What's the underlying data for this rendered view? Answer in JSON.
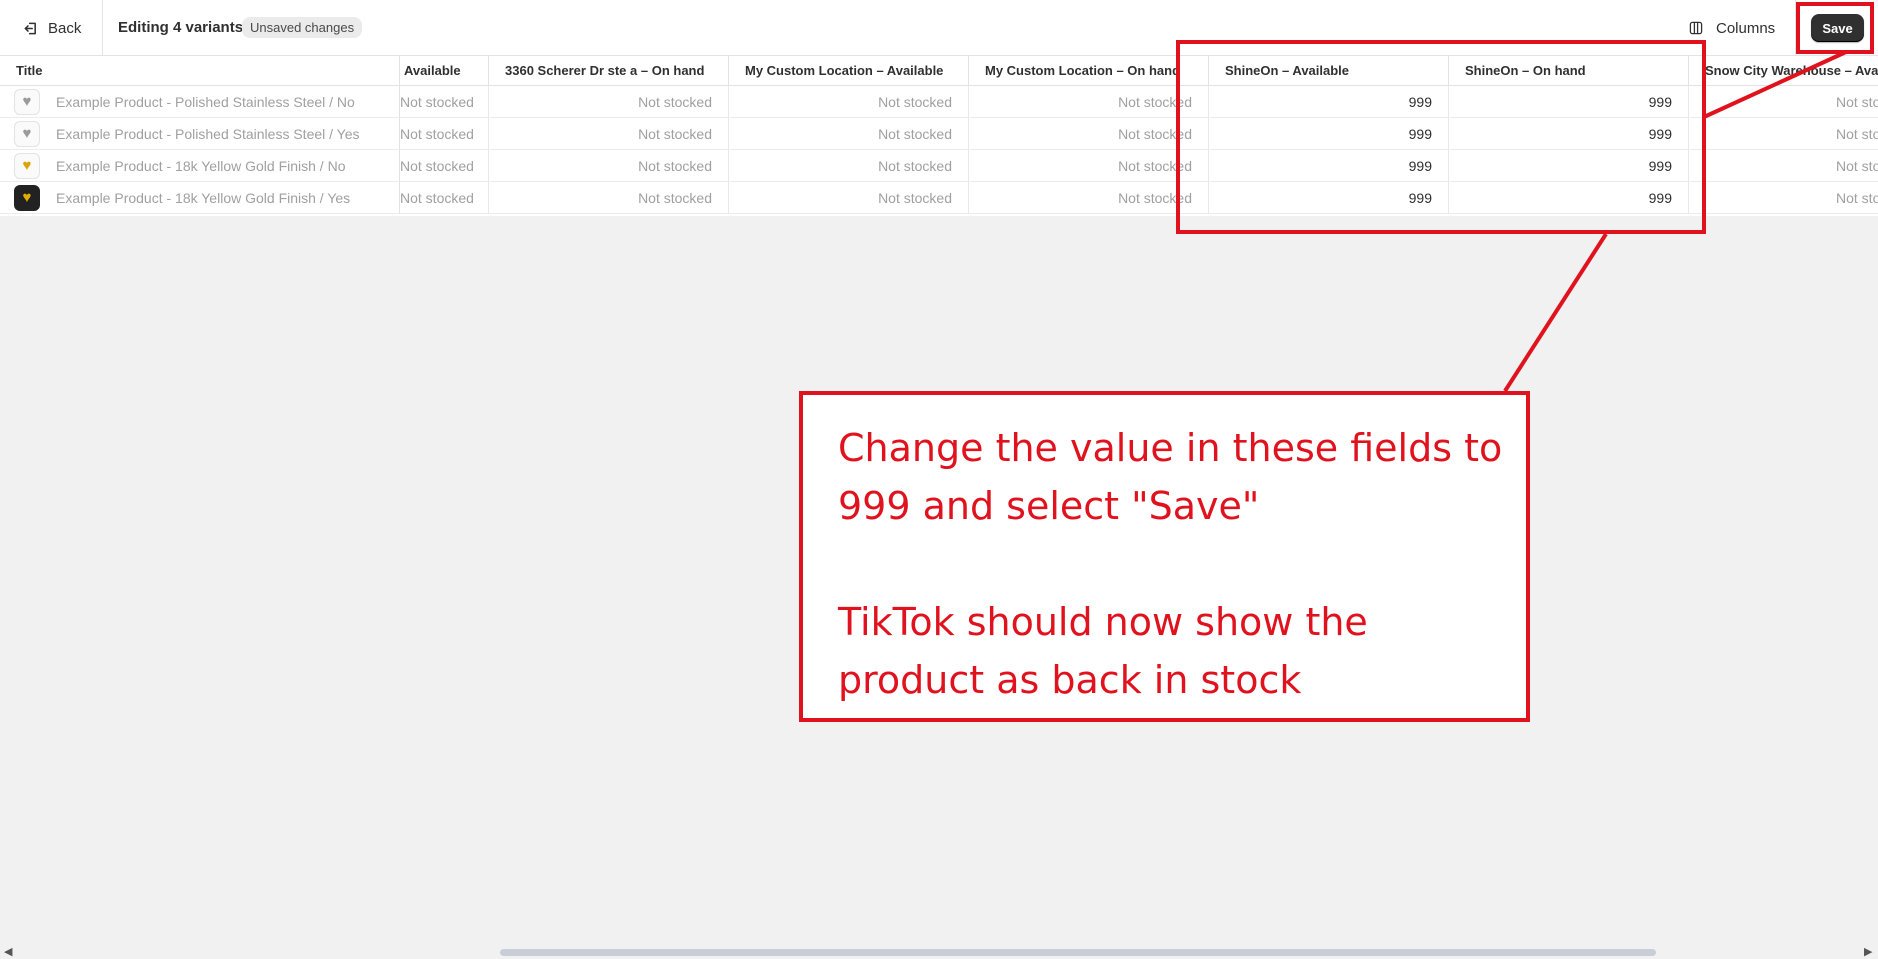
{
  "topbar": {
    "back_label": "Back",
    "title": "Editing 4 variants",
    "badge": "Unsaved changes",
    "columns_label": "Columns",
    "save_label": "Save"
  },
  "table": {
    "headers": [
      "Title",
      "Available",
      "3360 Scherer Dr ste a – On hand",
      "My Custom Location – Available",
      "My Custom Location – On hand",
      "ShineOn – Available",
      "ShineOn – On hand",
      "Snow City Warehouse – Availa"
    ],
    "rows": [
      {
        "title": "Example Product - Polished Stainless Steel / No",
        "thumb": "silver",
        "cells": [
          "Not stocked",
          "Not stocked",
          "Not stocked",
          "Not stocked",
          "999",
          "999",
          "Not sto"
        ]
      },
      {
        "title": "Example Product - Polished Stainless Steel / Yes",
        "thumb": "silver",
        "cells": [
          "Not stocked",
          "Not stocked",
          "Not stocked",
          "Not stocked",
          "999",
          "999",
          "Not sto"
        ]
      },
      {
        "title": "Example Product - 18k Yellow Gold Finish / No",
        "thumb": "gold",
        "cells": [
          "Not stocked",
          "Not stocked",
          "Not stocked",
          "Not stocked",
          "999",
          "999",
          "Not sto"
        ]
      },
      {
        "title": "Example Product - 18k Yellow Gold Finish / Yes",
        "thumb": "dark",
        "cells": [
          "Not stocked",
          "Not stocked",
          "Not stocked",
          "Not stocked",
          "999",
          "999",
          "Not sto"
        ]
      }
    ]
  },
  "annotation": {
    "line1": "Change the value in these fields to",
    "line2": "999 and select \"Save\"",
    "line3": "TikTok should now show the",
    "line4": "product as back in stock",
    "color": "#e0121d"
  },
  "icons": {
    "back": "exit-arrow-icon",
    "columns": "columns-icon",
    "pendant": "pendant-icon"
  }
}
